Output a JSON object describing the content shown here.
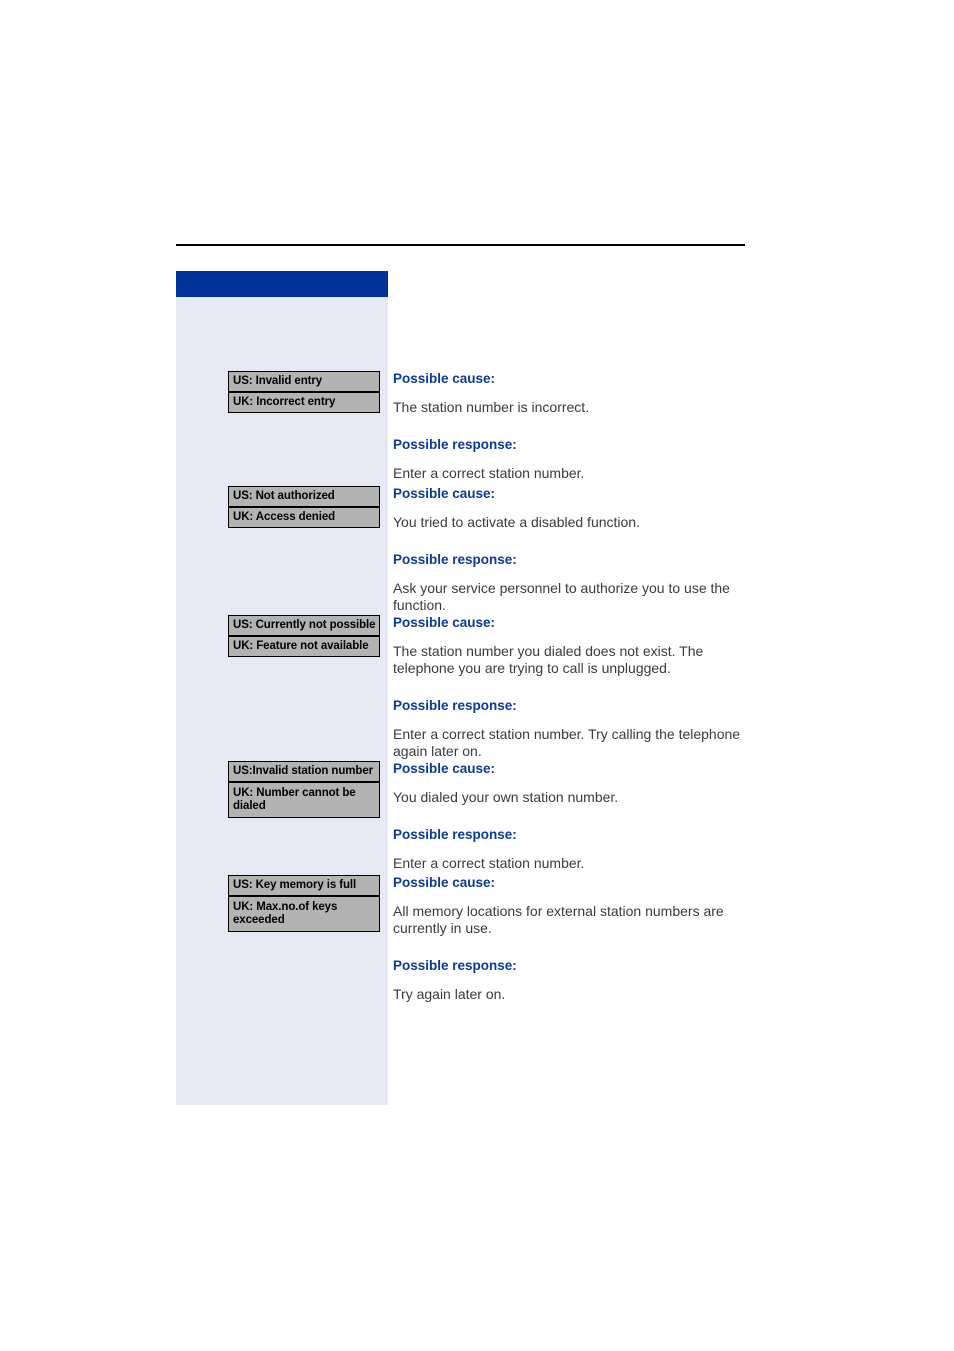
{
  "page": {
    "header_rule": true,
    "sidebar_title": "",
    "colors": {
      "accent_blue": "#003399",
      "heading_blue": "#0a3a9b",
      "sidebar_bg": "#e7eaf4",
      "display_box_bg": "#b3b3b3",
      "body_text": "#3b3b3b",
      "rule": "#000000"
    }
  },
  "labels": {
    "possible_cause": "Possible cause:",
    "possible_response": "Possible response:"
  },
  "entries": [
    {
      "display": {
        "us": "US: Invalid entry",
        "uk": "UK: Incorrect entry"
      },
      "cause": "The station number is incorrect.",
      "response": "Enter a correct station number."
    },
    {
      "display": {
        "us": "US: Not authorized",
        "uk": "UK: Access denied"
      },
      "cause": "You tried to activate a disabled function.",
      "response": "Ask your service personnel to authorize you to use the function."
    },
    {
      "display": {
        "us": "US: Currently not possible",
        "uk": "UK: Feature not available"
      },
      "cause": "The station number you dialed does not exist. The telephone you are trying to call is unplugged.",
      "response": "Enter a correct station number. Try calling the telephone again later on."
    },
    {
      "display": {
        "us": "US:Invalid station number",
        "uk": "UK: Number cannot be dialed"
      },
      "cause": "You dialed your own station number.",
      "response": "Enter a correct station number."
    },
    {
      "display": {
        "us": "US: Key memory is full",
        "uk": "UK: Max.no.of keys exceeded"
      },
      "cause": "All memory locations for external station numbers are currently in use.",
      "response": "Try again later on."
    }
  ]
}
